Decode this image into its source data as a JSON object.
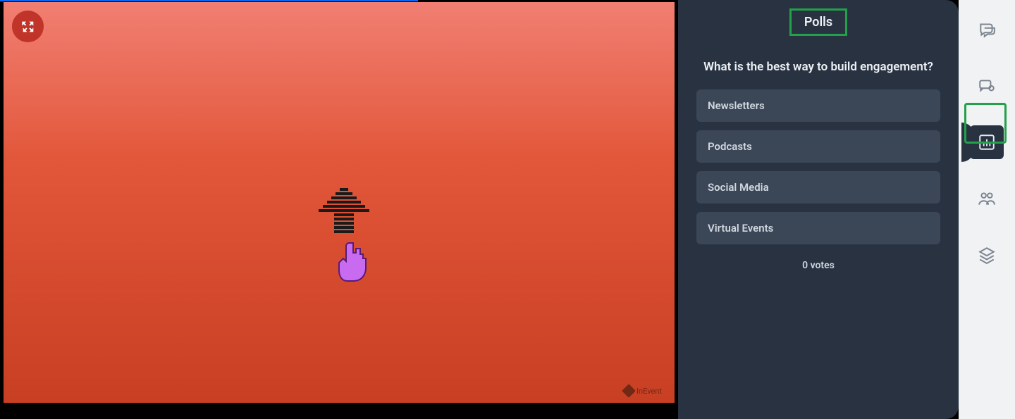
{
  "panel": {
    "title": "Polls",
    "question": "What is the best way to build engagement?",
    "options": [
      "Newsletters",
      "Podcasts",
      "Social Media",
      "Virtual Events"
    ],
    "votes_label": "0 votes"
  },
  "rail": {
    "items": [
      {
        "name": "chat",
        "active": false
      },
      {
        "name": "qna",
        "active": false
      },
      {
        "name": "polls",
        "active": true
      },
      {
        "name": "attendees",
        "active": false
      },
      {
        "name": "layers",
        "active": false
      }
    ]
  },
  "stage": {
    "watermark": "InEvent"
  }
}
